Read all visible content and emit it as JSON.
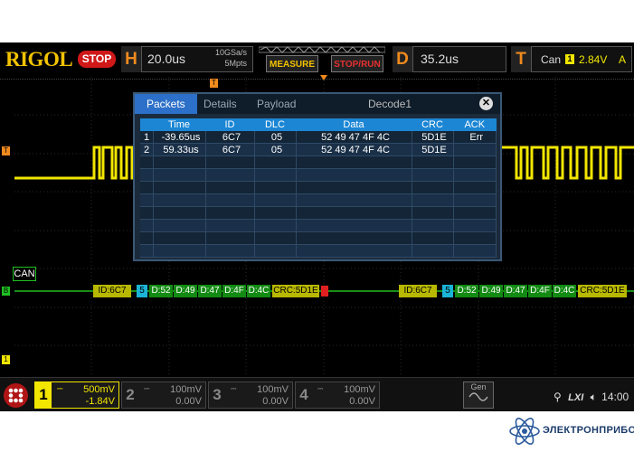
{
  "brand": "RIGOL",
  "run_state": "STOP",
  "horizontal": {
    "letter": "H",
    "timebase": "20.0us",
    "sample_rate": "10GSa/s",
    "memory": "5Mpts"
  },
  "buttons": {
    "measure": "MEASURE",
    "stop_run": "STOP/RUN"
  },
  "delay": {
    "letter": "D",
    "value": "35.2us"
  },
  "trigger": {
    "letter": "T",
    "type": "Can",
    "channel": "1",
    "level": "2.84V",
    "mode": "A"
  },
  "decode_panel": {
    "tabs": [
      "Packets",
      "Details",
      "Payload"
    ],
    "title": "Decode1",
    "columns": [
      "",
      "Time",
      "ID",
      "DLC",
      "Data",
      "CRC",
      "ACK"
    ],
    "rows": [
      [
        "1",
        "-39.65us",
        "6C7",
        "05",
        "52 49 47 4F 4C",
        "5D1E",
        "Err"
      ],
      [
        "2",
        "59.33us",
        "6C7",
        "05",
        "52 49 47 4F 4C",
        "5D1E",
        ""
      ]
    ],
    "empty_rows": 8
  },
  "bus": {
    "label": "CAN",
    "frame1": [
      "ID:6C7",
      "5",
      "D:52",
      "D:49",
      "D:47",
      "D:4F",
      "D:4C",
      "CRC:5D1E"
    ],
    "frame2": [
      "ID:6C7",
      "5",
      "D:52",
      "D:49",
      "D:47",
      "D:4F",
      "D:4C",
      "CRC:5D1E"
    ]
  },
  "channels": [
    {
      "num": "1",
      "scale": "500mV",
      "offset": "-1.84V",
      "active": true,
      "color": "#f2e600"
    },
    {
      "num": "2",
      "scale": "100mV",
      "offset": "0.00V",
      "active": false,
      "color": "#888888"
    },
    {
      "num": "3",
      "scale": "100mV",
      "offset": "0.00V",
      "active": false,
      "color": "#888888"
    },
    {
      "num": "4",
      "scale": "100mV",
      "offset": "0.00V",
      "active": false,
      "color": "#888888"
    }
  ],
  "gen_label": "Gen",
  "status": {
    "lxi": "LXI",
    "time": "14:00"
  },
  "footer": {
    "company": "ЭЛЕКТРОНПРИБОР"
  },
  "colors": {
    "ch1": "#f2e600",
    "bus": "#20c020",
    "accent": "#f08a1e"
  }
}
